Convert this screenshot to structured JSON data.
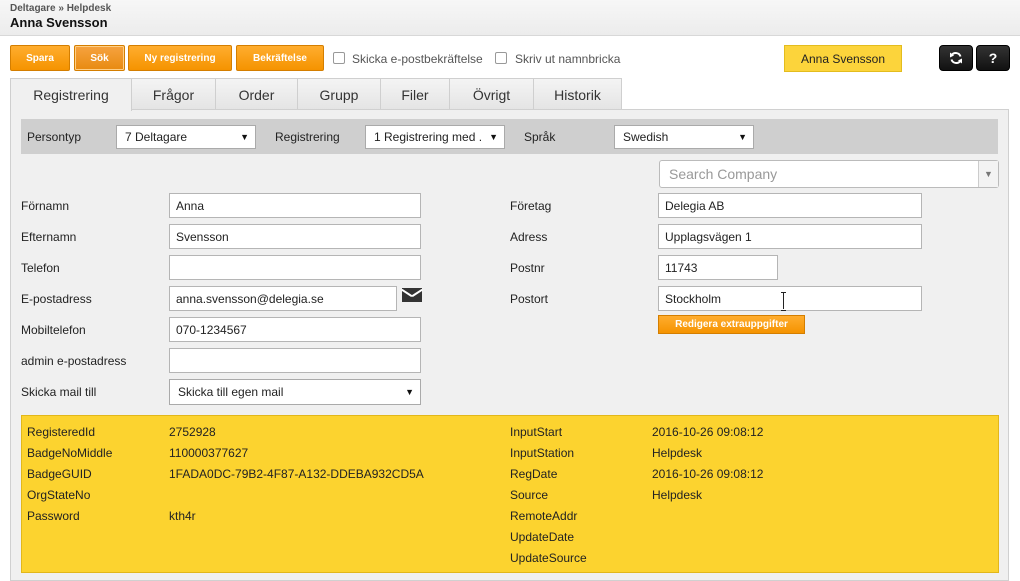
{
  "header": {
    "breadcrumb": "Deltagare » Helpdesk",
    "title": "Anna Svensson"
  },
  "toolbar": {
    "save": "Spara",
    "search": "Sök",
    "new": "Ny registrering",
    "confirm": "Bekräftelse",
    "send_email_confirm": "Skicka e-postbekräftelse",
    "print_badge": "Skriv ut namnbricka",
    "user": "Anna Svensson",
    "refresh_icon": "refresh-icon",
    "help": "?"
  },
  "tabs": [
    "Registrering",
    "Frågor",
    "Order",
    "Grupp",
    "Filer",
    "Övrigt",
    "Historik"
  ],
  "filters": {
    "persontyp_label": "Persontyp",
    "persontyp_value": "7 Deltagare",
    "registrering_label": "Registrering",
    "registrering_value": "1 Registrering med ...",
    "sprak_label": "Språk",
    "sprak_value": "Swedish"
  },
  "search_company": {
    "placeholder": "Search Company"
  },
  "form_left": {
    "fornamn_label": "Förnamn",
    "fornamn": "Anna",
    "efternamn_label": "Efternamn",
    "efternamn": "Svensson",
    "telefon_label": "Telefon",
    "telefon": "",
    "epost_label": "E-postadress",
    "epost": "anna.svensson@delegia.se",
    "mobil_label": "Mobiltelefon",
    "mobil": "070-1234567",
    "admin_epost_label": "admin e-postadress",
    "admin_epost": "",
    "skicka_label": "Skicka mail till",
    "skicka": "Skicka till egen mail"
  },
  "form_right": {
    "foretag_label": "Företag",
    "foretag": "Delegia AB",
    "adress_label": "Adress",
    "adress": "Upplagsvägen 1",
    "postnr_label": "Postnr",
    "postnr": "11743",
    "postort_label": "Postort",
    "postort": "Stockholm",
    "edit_extra": "Redigera extrauppgifter"
  },
  "info": {
    "left": [
      {
        "label": "RegisteredId",
        "value": "2752928"
      },
      {
        "label": "BadgeNoMiddle",
        "value": "110000377627"
      },
      {
        "label": "BadgeGUID",
        "value": "1FADA0DC-79B2-4F87-A132-DDEBA932CD5A"
      },
      {
        "label": "OrgStateNo",
        "value": ""
      },
      {
        "label": "Password",
        "value": "kth4r"
      }
    ],
    "right": [
      {
        "label": "InputStart",
        "value": "2016-10-26 09:08:12"
      },
      {
        "label": "InputStation",
        "value": "Helpdesk"
      },
      {
        "label": "RegDate",
        "value": "2016-10-26 09:08:12"
      },
      {
        "label": "Source",
        "value": "Helpdesk"
      },
      {
        "label": "RemoteAddr",
        "value": ""
      },
      {
        "label": "UpdateDate",
        "value": ""
      },
      {
        "label": "UpdateSource",
        "value": ""
      }
    ]
  }
}
